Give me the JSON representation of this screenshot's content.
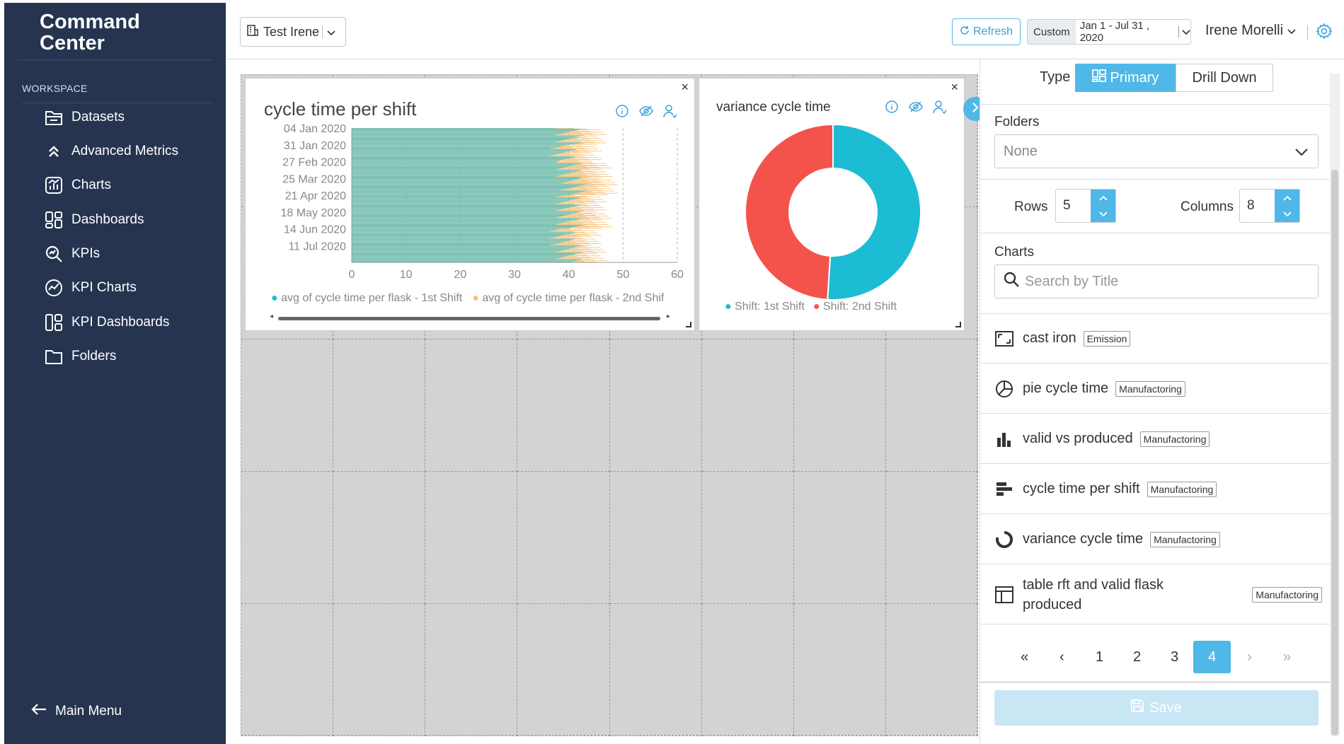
{
  "sidebar": {
    "brand_line1": "Command",
    "brand_line2": "Center",
    "workspace_label": "WORKSPACE",
    "items": [
      {
        "label": "Datasets",
        "icon": "folder-doc-icon"
      },
      {
        "label": "Advanced Metrics",
        "icon": "chevrons-up-icon"
      },
      {
        "label": "Charts",
        "icon": "chart-icon"
      },
      {
        "label": "Dashboards",
        "icon": "dashboard-icon"
      },
      {
        "label": "KPIs",
        "icon": "kpi-search-icon"
      },
      {
        "label": "KPI Charts",
        "icon": "kpi-chart-icon"
      },
      {
        "label": "KPI Dashboards",
        "icon": "kpi-dashboard-icon"
      },
      {
        "label": "Folders",
        "icon": "folder-icon"
      }
    ],
    "main_menu": "Main Menu"
  },
  "topbar": {
    "workspace_name": "Test Irene",
    "refresh_label": "Refresh",
    "date_custom": "Custom",
    "date_range": "Jan 1 - Jul 31 , 2020",
    "user_name": "Irene Morelli"
  },
  "cards": {
    "bar": {
      "title": "cycle time per shift",
      "legend1": "avg of cycle time per flask - 1st Shift",
      "legend2": "avg of cycle time per flask - 2nd Shif"
    },
    "donut": {
      "title": "variance cycle time",
      "legend1": "Shift: 1st Shift",
      "legend2": "Shift: 2nd Shift"
    }
  },
  "chart_data": [
    {
      "type": "bar",
      "orientation": "horizontal",
      "title": "cycle time per shift",
      "categories": [
        "04 Jan 2020",
        "31 Jan 2020",
        "27 Feb 2020",
        "25 Mar 2020",
        "21 Apr 2020",
        "18 May 2020",
        "14 Jun 2020",
        "11 Jul 2020"
      ],
      "xlim": [
        0,
        60
      ],
      "x_ticks": [
        "0",
        "10",
        "20",
        "30",
        "40",
        "50",
        "60"
      ],
      "series": [
        {
          "name": "avg of cycle time per flask - 1st Shift",
          "color": "#1bbcd4",
          "values": [
            40,
            39,
            40,
            41,
            40,
            40,
            39,
            40
          ]
        },
        {
          "name": "avg of cycle time per flask - 2nd Shif",
          "color": "#f6c27a",
          "values": [
            44,
            43,
            45,
            46,
            44,
            45,
            43,
            44
          ]
        }
      ]
    },
    {
      "type": "pie",
      "title": "variance cycle time",
      "donut": true,
      "series": [
        {
          "name": "Shift: 1st Shift",
          "color": "#1bbcd4",
          "value": 51
        },
        {
          "name": "Shift: 2nd Shift",
          "color": "#f4534b",
          "value": 49
        }
      ]
    }
  ],
  "panel": {
    "type_label": "Type",
    "type_primary": "Primary",
    "type_drill": "Drill Down",
    "folders_label": "Folders",
    "folders_value": "None",
    "rows_label": "Rows",
    "rows_value": "5",
    "columns_label": "Columns",
    "columns_value": "8",
    "charts_label": "Charts",
    "search_placeholder": "Search by Title",
    "charts": [
      {
        "name": "cast iron",
        "tag": "Emission",
        "icon": "kpi-frame-icon"
      },
      {
        "name": "pie cycle time",
        "tag": "Manufactoring",
        "icon": "pie-icon"
      },
      {
        "name": "valid vs produced",
        "tag": "Manufactoring",
        "icon": "bar-chart-icon"
      },
      {
        "name": "cycle time per shift",
        "tag": "Manufactoring",
        "icon": "hbar-chart-icon"
      },
      {
        "name": "variance cycle time",
        "tag": "Manufactoring",
        "icon": "donut-icon"
      },
      {
        "name": "table rft and valid flask produced",
        "tag": "Manufactoring",
        "icon": "table-icon"
      }
    ],
    "pages": [
      "1",
      "2",
      "3",
      "4"
    ],
    "active_page": "4",
    "save_label": "Save"
  }
}
